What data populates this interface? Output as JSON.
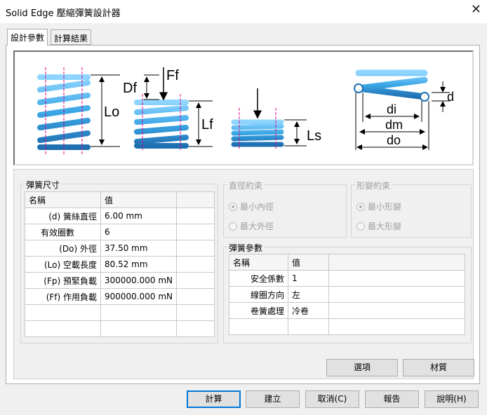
{
  "window": {
    "title": "Solid Edge 壓縮彈簧設計器",
    "close_glyph": "✕"
  },
  "tabs": [
    {
      "label": "設計參數"
    },
    {
      "label": "計算結果"
    }
  ],
  "diagram": {
    "labels": {
      "lo": "Lo",
      "df": "Df",
      "ff": "Ff",
      "lf": "Lf",
      "ls": "Ls",
      "d": "d",
      "di": "di",
      "dm": "dm",
      "do": "do"
    },
    "spring_color": "#3ba7e6",
    "dim_color": "#000000",
    "axis_color": "#e0008a"
  },
  "spring_size": {
    "title": "彈簧尺寸",
    "headers": [
      "名稱",
      "值"
    ],
    "rows": [
      {
        "name": "(d) 簧絲直徑",
        "value": "6.00 mm"
      },
      {
        "name": "有效圈數",
        "value": "6"
      },
      {
        "name": "(Do) 外徑",
        "value": "37.50 mm"
      },
      {
        "name": "(Lo) 空載長度",
        "value": "80.52 mm"
      },
      {
        "name": "(Fp) 預緊負載",
        "value": "300000.000 mN"
      },
      {
        "name": "(Ff) 作用負載",
        "value": "900000.000 mN"
      }
    ]
  },
  "diameter_constraint": {
    "title": "直徑約束",
    "options": [
      "最小內徑",
      "最大外徑"
    ],
    "selected": "最小內徑"
  },
  "deform_constraint": {
    "title": "形變約束",
    "options": [
      "最小形變",
      "最大形變"
    ],
    "selected": "最小形變"
  },
  "spring_params": {
    "title": "彈簧參數",
    "headers": [
      "名稱",
      "值"
    ],
    "rows": [
      {
        "name": "安全係數",
        "value": "1"
      },
      {
        "name": "線圈方向",
        "value": "左"
      },
      {
        "name": "卷簧處理",
        "value": "冷卷"
      }
    ]
  },
  "buttons": {
    "options": "選項",
    "material": "材質",
    "calculate": "計算",
    "create": "建立",
    "cancel": "取消(C)",
    "report": "報告",
    "help": "說明(H)"
  }
}
